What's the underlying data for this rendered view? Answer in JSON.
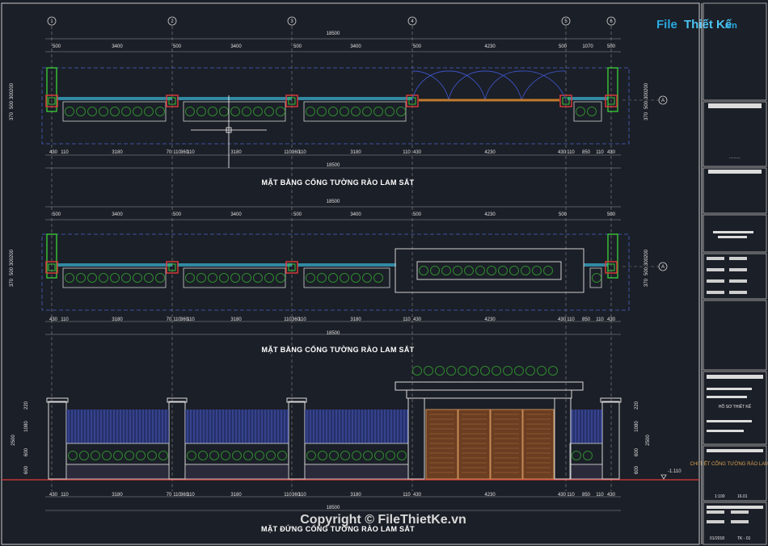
{
  "logo": {
    "part1": "File",
    "part2": "Thiết Kế",
    "part3": ".vn",
    "color1": "#2aa8e0",
    "color2": "#4cc3f0"
  },
  "axes": [
    "1",
    "2",
    "3",
    "4",
    "5",
    "6"
  ],
  "axis_letter": "A",
  "top_dims": [
    "500",
    "3400",
    "500",
    "3400",
    "500",
    "3400",
    "500",
    "4230",
    "500",
    "1070",
    "500"
  ],
  "total_dim": "18500",
  "plan1_bottom_dims": [
    "430",
    "110",
    "3180",
    "70",
    "110",
    "360",
    "110",
    "3180",
    "110",
    "360",
    "110",
    "3180",
    "110",
    "430",
    "4230",
    "430",
    "110",
    "850",
    "110",
    "430"
  ],
  "plan2_top_dims": [
    "500",
    "3400",
    "500",
    "3400",
    "500",
    "3400",
    "500",
    "4230",
    "500",
    "500"
  ],
  "side_dims": [
    "370",
    "500",
    "300",
    "200"
  ],
  "elev_side_dims": [
    "220",
    "1080",
    "600",
    "600",
    "2500"
  ],
  "level_mark": "-1.110",
  "titles": {
    "plan1": "MẶT BẰNG CỔNG TƯỜNG RÀO LAM SẮT",
    "plan2": "MẶT BẰNG CỔNG TƯỜNG RÀO LAM SẮT",
    "elevation": "MẶT ĐỨNG CỔNG TƯỜNG RÀO LAM SẮT"
  },
  "copyright": "Copyright © FileThietKe.vn",
  "title_block": {
    "name_small": "HỒ SƠ THIẾT KẾ",
    "drawing_name": "CHI TIẾT CỔNG TƯỜNG RÀO LAM SẮT",
    "scale": "1:100",
    "sheet": "16.01",
    "date": "01/2018",
    "code": "TK - 01"
  },
  "colors": {
    "green": "#38c738",
    "red": "#e03a3a",
    "blue": "#2f3ea0",
    "cyan": "#3ab7d9",
    "plant": "#2f8a2f",
    "door": "#6b3e22"
  }
}
